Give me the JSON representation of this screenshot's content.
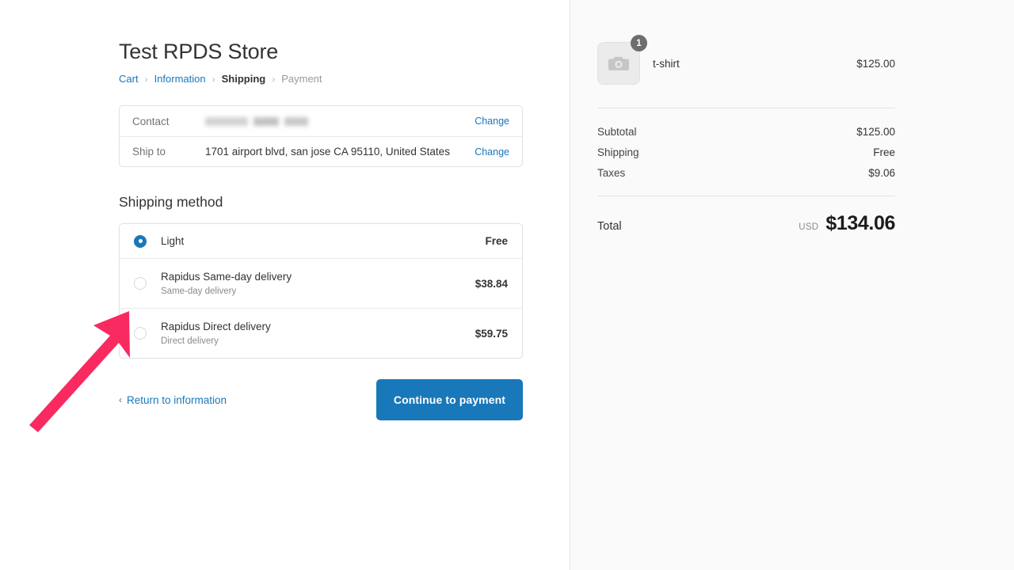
{
  "store": {
    "title": "Test RPDS Store"
  },
  "breadcrumb": {
    "separator": "›",
    "items": [
      {
        "label": "Cart",
        "state": "link"
      },
      {
        "label": "Information",
        "state": "link"
      },
      {
        "label": "Shipping",
        "state": "current"
      },
      {
        "label": "Payment",
        "state": "upcoming"
      }
    ]
  },
  "review": {
    "contact": {
      "label": "Contact",
      "value": "",
      "redacted": true,
      "change_label": "Change"
    },
    "ship_to": {
      "label": "Ship to",
      "value": "1701 airport blvd, san jose CA 95110, United States",
      "change_label": "Change"
    }
  },
  "shipping": {
    "section_title": "Shipping method",
    "options": [
      {
        "name": "Light",
        "description": "",
        "price": "Free",
        "selected": true
      },
      {
        "name": "Rapidus Same-day delivery",
        "description": "Same-day delivery",
        "price": "$38.84",
        "selected": false
      },
      {
        "name": "Rapidus Direct delivery",
        "description": "Direct delivery",
        "price": "$59.75",
        "selected": false
      }
    ]
  },
  "actions": {
    "return_label": "Return to information",
    "return_chevron": "‹",
    "continue_label": "Continue to payment"
  },
  "summary": {
    "items": [
      {
        "name": "t-shirt",
        "price": "$125.00",
        "quantity": "1",
        "thumbnail_icon": "camera-placeholder-icon"
      }
    ],
    "totals": [
      {
        "label": "Subtotal",
        "value": "$125.00"
      },
      {
        "label": "Shipping",
        "value": "Free"
      },
      {
        "label": "Taxes",
        "value": "$9.06"
      }
    ],
    "grand_total": {
      "label": "Total",
      "currency": "USD",
      "value": "$134.06"
    }
  },
  "annotation": {
    "type": "arrow",
    "color": "#f92a60",
    "points_to": "shipping-option-boundary"
  },
  "colors": {
    "accent_blue": "#1878b9",
    "panel_bg": "#fafafa",
    "border": "#e1e1e1",
    "annotation_pink": "#f92a60"
  }
}
